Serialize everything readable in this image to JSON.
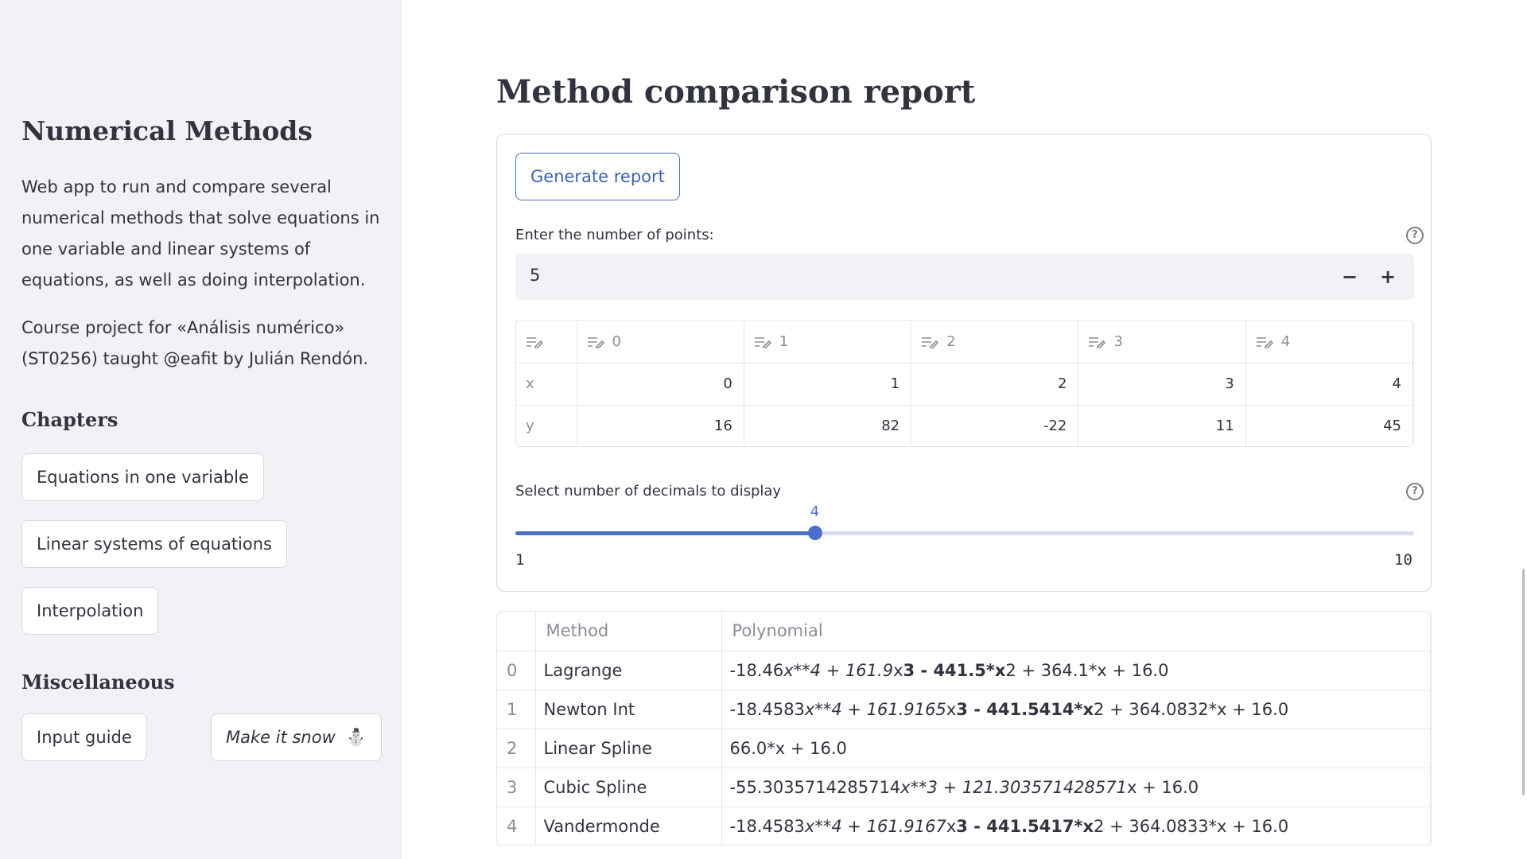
{
  "sidebar": {
    "title": "Numerical Methods",
    "description": "Web app to run and compare several numerical methods that solve equations in one variable and linear systems of equations, as well as doing interpolation.",
    "course": "Course project for «Análisis numérico» (ST0256) taught @eafit by Julián Rendón.",
    "chapters_heading": "Chapters",
    "chapters": [
      "Equations in one variable",
      "Linear systems of equations",
      "Interpolation"
    ],
    "misc_heading": "Miscellaneous",
    "input_guide": "Input guide",
    "make_it_snow": "Make it snow",
    "snowman": "⛄"
  },
  "main": {
    "title": "Method comparison report",
    "generate_button": "Generate report",
    "points_label": "Enter the number of points:",
    "points_value": "5",
    "minus": "−",
    "plus": "+",
    "help": "?",
    "grid": {
      "columns": [
        "0",
        "1",
        "2",
        "3",
        "4"
      ],
      "rows": [
        {
          "label": "x",
          "values": [
            "0",
            "1",
            "2",
            "3",
            "4"
          ]
        },
        {
          "label": "y",
          "values": [
            "16",
            "82",
            "-22",
            "11",
            "45"
          ]
        }
      ]
    },
    "decimals_label": "Select number of decimals to display",
    "decimals_value": "4",
    "decimals_min": "1",
    "decimals_max": "10",
    "decimals_fraction": 0.3333
  },
  "results": {
    "headers": [
      "Method",
      "Polynomial"
    ],
    "rows": [
      {
        "index": "0",
        "method": "Lagrange",
        "poly": [
          [
            "-18.46",
            "n"
          ],
          [
            "x**4 + 161.9",
            "i"
          ],
          [
            "x",
            "n"
          ],
          [
            "3 - 441.5*x",
            "b"
          ],
          [
            "2 + 364.1*x + 16.0",
            "n"
          ]
        ]
      },
      {
        "index": "1",
        "method": "Newton Int",
        "poly": [
          [
            "-18.4583",
            "n"
          ],
          [
            "x**4 + 161.9165",
            "i"
          ],
          [
            "x",
            "n"
          ],
          [
            "3 - 441.5414*x",
            "b"
          ],
          [
            "2 + 364.0832*x + 16.0",
            "n"
          ]
        ]
      },
      {
        "index": "2",
        "method": "Linear Spline",
        "poly": [
          [
            "66.0*x + 16.0",
            "n"
          ]
        ]
      },
      {
        "index": "3",
        "method": "Cubic Spline",
        "poly": [
          [
            "-55.3035714285714",
            "n"
          ],
          [
            "x**3 + 121.303571428571",
            "i"
          ],
          [
            "x + 16.0",
            "n"
          ]
        ]
      },
      {
        "index": "4",
        "method": "Vandermonde",
        "poly": [
          [
            "-18.4583",
            "n"
          ],
          [
            "x**4 + 161.9167",
            "i"
          ],
          [
            "x",
            "n"
          ],
          [
            "3 - 441.5417*x",
            "b"
          ],
          [
            "2 + 364.0833*x + 16.0",
            "n"
          ]
        ]
      }
    ]
  }
}
